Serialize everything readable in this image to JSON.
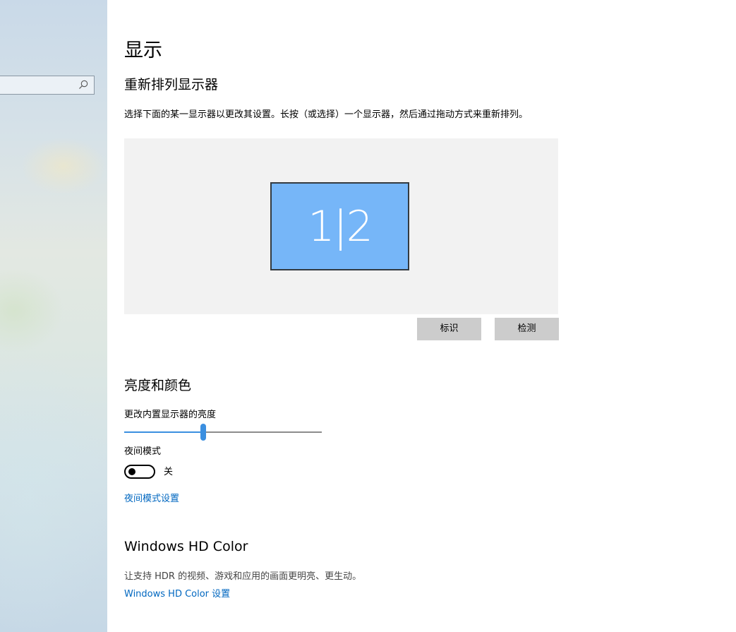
{
  "sidebar": {
    "search": {
      "placeholder": ""
    }
  },
  "page": {
    "title": "显示"
  },
  "rearrange": {
    "heading": "重新排列显示器",
    "description": "选择下面的某一显示器以更改其设置。长按（或选择）一个显示器，然后通过拖动方式来重新排列。",
    "monitor_label": "1|2",
    "identify_button": "标识",
    "detect_button": "检测"
  },
  "brightness": {
    "heading": "亮度和颜色",
    "slider_label": "更改内置显示器的亮度",
    "slider_value_fraction": 0.4,
    "night_light_label": "夜间模式",
    "night_light_state": "关",
    "night_light_on": false,
    "night_light_settings_link": "夜间模式设置"
  },
  "hdr": {
    "heading": "Windows HD Color",
    "description": "让支持 HDR 的视频、游戏和应用的画面更明亮、更生动。",
    "settings_link": "Windows HD Color 设置"
  },
  "colors": {
    "accent": "#0067c0",
    "slider": "#3b8fe0",
    "monitor_fill": "#76b6f8",
    "button_bg": "#cccccc",
    "arrange_bg": "#f2f2f2"
  }
}
